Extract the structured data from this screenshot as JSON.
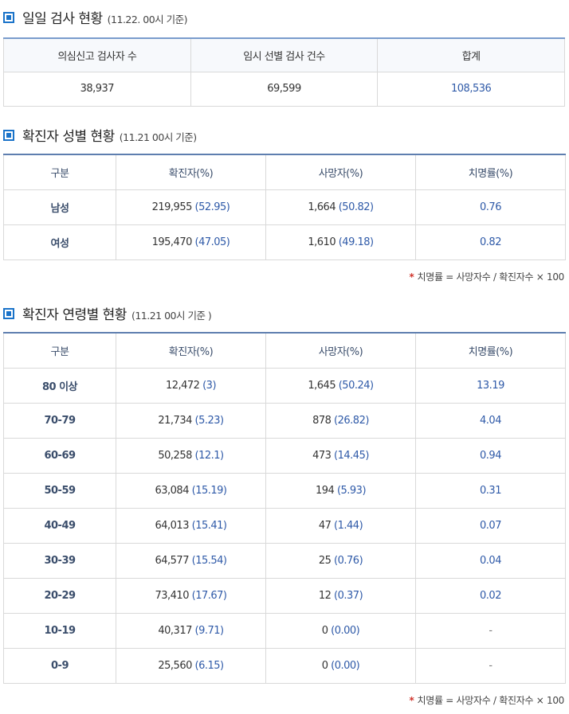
{
  "daily": {
    "title": "일일 검사 현황",
    "subtitle": "(11.22. 00시 기준)",
    "headers": [
      "의심신고 검사자 수",
      "임시 선별 검사 건수",
      "합계"
    ],
    "values": [
      "38,937",
      "69,599",
      "108,536"
    ]
  },
  "gender": {
    "title": "확진자 성별 현황",
    "subtitle": "(11.21 00시 기준)",
    "headers": [
      "구분",
      "확진자(%)",
      "사망자(%)",
      "치명률(%)"
    ],
    "rows": [
      {
        "label": "남성",
        "confirmed": "219,955",
        "confirmed_pct": "(52.95)",
        "deaths": "1,664",
        "deaths_pct": "(50.82)",
        "fatality": "0.76"
      },
      {
        "label": "여성",
        "confirmed": "195,470",
        "confirmed_pct": "(47.05)",
        "deaths": "1,610",
        "deaths_pct": "(49.18)",
        "fatality": "0.82"
      }
    ],
    "note_mark": "*",
    "note": "치명률 = 사망자수 / 확진자수 × 100"
  },
  "age": {
    "title": "확진자 연령별 현황",
    "subtitle": "(11.21 00시 기준 )",
    "headers": [
      "구분",
      "확진자(%)",
      "사망자(%)",
      "치명률(%)"
    ],
    "rows": [
      {
        "label": "80 이상",
        "confirmed": "12,472",
        "confirmed_pct": "(3)",
        "deaths": "1,645",
        "deaths_pct": "(50.24)",
        "fatality": "13.19"
      },
      {
        "label": "70-79",
        "confirmed": "21,734",
        "confirmed_pct": "(5.23)",
        "deaths": "878",
        "deaths_pct": "(26.82)",
        "fatality": "4.04"
      },
      {
        "label": "60-69",
        "confirmed": "50,258",
        "confirmed_pct": "(12.1)",
        "deaths": "473",
        "deaths_pct": "(14.45)",
        "fatality": "0.94"
      },
      {
        "label": "50-59",
        "confirmed": "63,084",
        "confirmed_pct": "(15.19)",
        "deaths": "194",
        "deaths_pct": "(5.93)",
        "fatality": "0.31"
      },
      {
        "label": "40-49",
        "confirmed": "64,013",
        "confirmed_pct": "(15.41)",
        "deaths": "47",
        "deaths_pct": "(1.44)",
        "fatality": "0.07"
      },
      {
        "label": "30-39",
        "confirmed": "64,577",
        "confirmed_pct": "(15.54)",
        "deaths": "25",
        "deaths_pct": "(0.76)",
        "fatality": "0.04"
      },
      {
        "label": "20-29",
        "confirmed": "73,410",
        "confirmed_pct": "(17.67)",
        "deaths": "12",
        "deaths_pct": "(0.37)",
        "fatality": "0.02"
      },
      {
        "label": "10-19",
        "confirmed": "40,317",
        "confirmed_pct": "(9.71)",
        "deaths": "0",
        "deaths_pct": "(0.00)",
        "fatality": "-"
      },
      {
        "label": "0-9",
        "confirmed": "25,560",
        "confirmed_pct": "(6.15)",
        "deaths": "0",
        "deaths_pct": "(0.00)",
        "fatality": "-"
      }
    ],
    "note_mark": "*",
    "note": "치명률 = 사망자수 / 확진자수 × 100"
  }
}
